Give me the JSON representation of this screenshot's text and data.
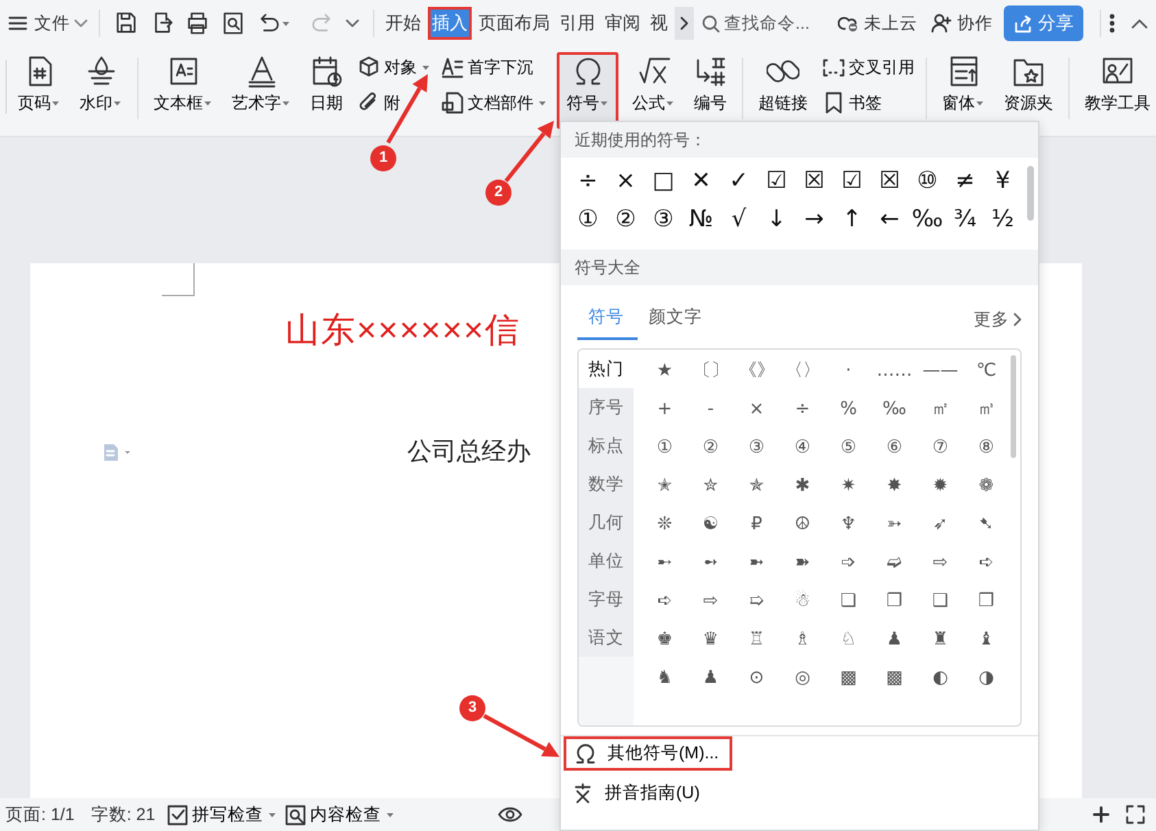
{
  "menu_bar": {
    "file_menu": "文件",
    "tabs": [
      {
        "label": "开始",
        "selected": false,
        "annotated": false
      },
      {
        "label": "插入",
        "selected": true,
        "annotated": true
      },
      {
        "label": "页面布局",
        "selected": false,
        "annotated": false
      },
      {
        "label": "引用",
        "selected": false,
        "annotated": false
      },
      {
        "label": "审阅",
        "selected": false,
        "annotated": false
      },
      {
        "label": "视",
        "selected": false,
        "annotated": false
      }
    ],
    "search": {
      "placeholder": "查找命令..."
    },
    "cloud_status": "未上云",
    "collaborate": "协作",
    "share": "分享"
  },
  "ribbon": {
    "groups": [
      {
        "columns": [
          {
            "kind": "large",
            "label": "页码",
            "dropdown": true,
            "highlighted": false,
            "annotated": false
          },
          {
            "kind": "large",
            "label": "水印",
            "dropdown": true,
            "highlighted": false,
            "annotated": false
          }
        ]
      },
      {
        "columns": [
          {
            "kind": "large",
            "label": "文本框",
            "dropdown": true,
            "highlighted": false,
            "annotated": false
          },
          {
            "kind": "large",
            "label": "艺术字",
            "dropdown": true,
            "highlighted": false,
            "annotated": false
          },
          {
            "kind": "large",
            "label": "日期",
            "dropdown": false,
            "highlighted": false,
            "annotated": false
          },
          {
            "kind": "stack",
            "items": [
              {
                "label": "对象",
                "dropdown": true
              },
              {
                "label": "附",
                "dropdown": false
              }
            ]
          },
          {
            "kind": "stack",
            "items": [
              {
                "label": "首字下沉",
                "dropdown": false
              },
              {
                "label": "文档部件",
                "dropdown": true
              }
            ]
          },
          {
            "kind": "large",
            "label": "符号",
            "dropdown": true,
            "highlighted": true,
            "annotated": true
          },
          {
            "kind": "large",
            "label": "公式",
            "dropdown": true,
            "highlighted": false,
            "annotated": false
          },
          {
            "kind": "large",
            "label": "编号",
            "dropdown": false,
            "highlighted": false,
            "annotated": false
          }
        ]
      },
      {
        "columns": [
          {
            "kind": "large",
            "label": "超链接",
            "dropdown": false,
            "highlighted": false,
            "annotated": false
          },
          {
            "kind": "stack",
            "items": [
              {
                "label": "交叉引用",
                "dropdown": false
              },
              {
                "label": "书签",
                "dropdown": false
              }
            ]
          }
        ]
      },
      {
        "columns": [
          {
            "kind": "large",
            "label": "窗体",
            "dropdown": true,
            "highlighted": false,
            "annotated": false
          },
          {
            "kind": "large",
            "label": "资源夹",
            "dropdown": false,
            "highlighted": false,
            "annotated": false
          }
        ]
      },
      {
        "columns": [
          {
            "kind": "large",
            "label": "教学工具",
            "dropdown": false,
            "highlighted": false,
            "annotated": false
          }
        ]
      }
    ]
  },
  "document": {
    "title": "山东××××××信",
    "subtitle": "公司总经办"
  },
  "symbol_panel": {
    "recent_title": "近期使用的符号：",
    "recent": [
      "÷",
      "×",
      "□",
      "✕",
      "✓",
      "☑",
      "☒",
      "☑",
      "☒",
      "⑩",
      "≠",
      "¥",
      "①",
      "②",
      "③",
      "№",
      "√",
      "↓",
      "→",
      "↑",
      "←",
      "‰",
      "¾",
      "½"
    ],
    "library_title": "符号大全",
    "tabs": [
      {
        "label": "符号",
        "selected": true
      },
      {
        "label": "颜文字",
        "selected": false
      }
    ],
    "more": "更多",
    "categories": [
      {
        "label": "热门",
        "selected": true
      },
      {
        "label": "序号",
        "selected": false
      },
      {
        "label": "标点",
        "selected": false
      },
      {
        "label": "数学",
        "selected": false
      },
      {
        "label": "几何",
        "selected": false
      },
      {
        "label": "单位",
        "selected": false
      },
      {
        "label": "字母",
        "selected": false
      },
      {
        "label": "语文",
        "selected": false
      }
    ],
    "symbols": [
      "★",
      "〔〕",
      "《》",
      "〈〉",
      "·",
      "……",
      "——",
      "℃",
      "+",
      "-",
      "×",
      "÷",
      "%",
      "‰",
      "㎡",
      "㎥",
      "①",
      "②",
      "③",
      "④",
      "⑤",
      "⑥",
      "⑦",
      "⑧",
      "✭",
      "✮",
      "✯",
      "✱",
      "✷",
      "✸",
      "✹",
      "❁",
      "❊",
      "☯",
      "₽",
      "☮",
      "♆",
      "➳",
      "➶",
      "➷",
      "➸",
      "➻",
      "➼",
      "➽",
      "➩",
      "➫",
      "⇨",
      "➪",
      "➪",
      "⇨",
      "➯",
      "☃",
      "❏",
      "❐",
      "❑",
      "❒",
      "♚",
      "♛",
      "♖",
      "♗",
      "♘",
      "♟",
      "♜",
      "♝",
      "♞",
      "♟",
      "⊙",
      "◎",
      "▩",
      "▩",
      "◐",
      "◑"
    ],
    "actions": [
      {
        "label": "其他符号(M)...",
        "annotated": true
      },
      {
        "label": "拼音指南(U)",
        "annotated": false
      }
    ]
  },
  "status_bar": {
    "page_count": "页面: 1/1",
    "word_count": "字数: 21",
    "checks": [
      {
        "label": "拼写检查",
        "dropdown": true
      },
      {
        "label": "内容检查",
        "dropdown": true
      }
    ]
  },
  "callouts": [
    {
      "number": "1"
    },
    {
      "number": "2"
    },
    {
      "number": "3"
    }
  ]
}
